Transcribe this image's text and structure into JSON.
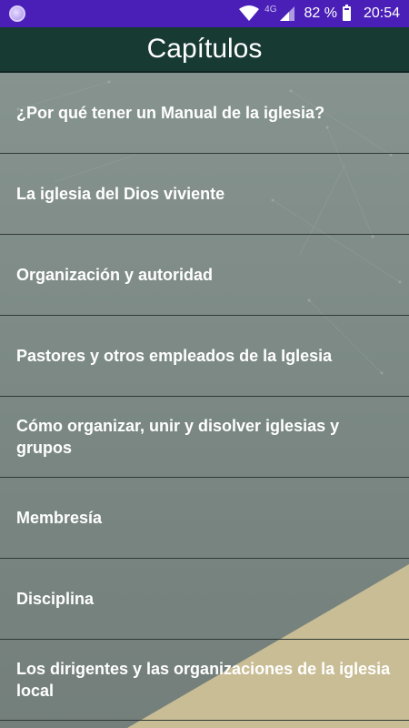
{
  "status_bar": {
    "network": "4G",
    "battery": "82 %",
    "time": "20:54"
  },
  "header": {
    "title": "Capítulos"
  },
  "chapters": [
    {
      "label": "¿Por qué tener un Manual de la iglesia?"
    },
    {
      "label": "La iglesia del Dios viviente"
    },
    {
      "label": "Organización y autoridad"
    },
    {
      "label": "Pastores y otros empleados de la Iglesia"
    },
    {
      "label": "Cómo organizar, unir y disolver iglesias y grupos"
    },
    {
      "label": "Membresía"
    },
    {
      "label": "Disciplina"
    },
    {
      "label": "Los dirigentes y las organizaciones de la iglesia local"
    }
  ],
  "colors": {
    "status_bar": "#4a1fb8",
    "header": "#173a33",
    "list_background": "#7d8a85",
    "accent_triangle": "#c9bd95"
  }
}
